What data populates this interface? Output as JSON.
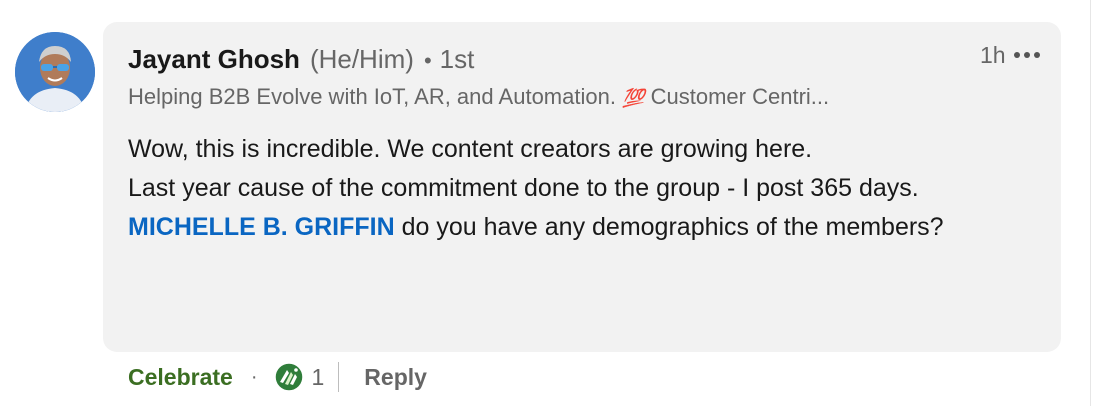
{
  "comment": {
    "author_name": "Jayant Ghosh",
    "pronouns": "(He/Him)",
    "separator": "•",
    "connection_degree": "1st",
    "headline_before_emoji": "Helping B2B Evolve with IoT, AR, and Automation.",
    "headline_emoji": "💯",
    "headline_after_emoji": "Customer Centri...",
    "timestamp": "1h",
    "more_icon": "more-horizontal-icon",
    "body_lines": [
      "Wow, this is incredible. We content creators are growing here.",
      "Last year cause of the commitment done to the group - I post 365 days."
    ],
    "mention": "MICHELLE B. GRIFFIN",
    "mention_followup": " do you have any demographics of the members?"
  },
  "actions": {
    "celebrate_label": "Celebrate",
    "separator": "·",
    "reaction_icon": "celebrate-reaction-icon",
    "reaction_count": "1",
    "reply_label": "Reply"
  },
  "colors": {
    "bubble_background": "#f2f2f2",
    "mention": "#0a66c2",
    "celebrate": "#3b6e22",
    "secondary_text": "#666666"
  }
}
